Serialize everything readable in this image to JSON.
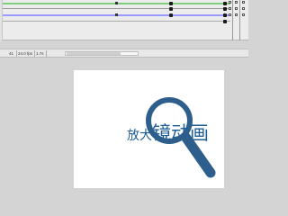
{
  "status": {
    "frame": "41",
    "fps": "24.0 fps",
    "time": "1.7s"
  },
  "stage": {
    "text_small": "放大",
    "text_big": "镜动画",
    "text_color": "#1d5e96",
    "magnifier_color": "#2e5f8c",
    "background": "#ffffff"
  },
  "timeline": {
    "layer_colors": [
      "#8fd18f",
      "#9999ff"
    ],
    "icons": [
      "keyframe-icon",
      "lock-icon",
      "outline-icon"
    ]
  }
}
